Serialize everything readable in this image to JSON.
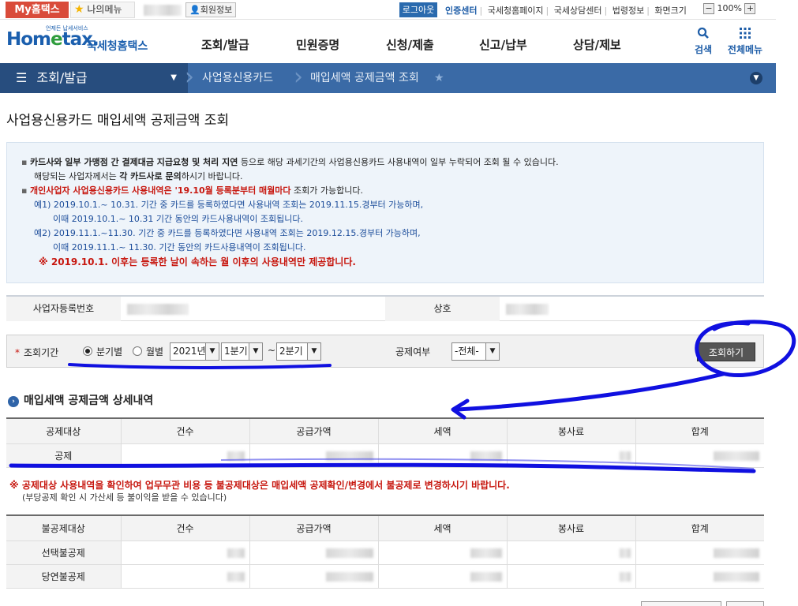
{
  "utility": {
    "my_tab": "My홈택스",
    "my_menu": "나의메뉴",
    "member_info": "회원정보",
    "logout": "로그아웃",
    "links": [
      "인증센터",
      "국세청홈페이지",
      "국세상담센터",
      "법령정보",
      "화면크기"
    ],
    "zoom_minus": "−",
    "zoom_level": "100%",
    "zoom_plus": "+"
  },
  "header": {
    "logo_small": "언제든 납세서비스",
    "logo_main_a": "Hom",
    "logo_main_b": "e",
    "logo_main_c": "tax.",
    "logo_org": "국세청홈택스",
    "menu": [
      "조회/발급",
      "민원증명",
      "신청/제출",
      "신고/납부",
      "상담/제보"
    ],
    "search": "검색",
    "all_menu": "전체메뉴",
    "icons": {
      "search": "search-icon",
      "all_menu": "grid-icon"
    }
  },
  "location": {
    "first": "조회/발급",
    "items": [
      "사업용신용카드",
      "매입세액 공제금액 조회"
    ]
  },
  "page_title": "사업용신용카드 매입세액 공제금액 조회",
  "info": {
    "line1_bold": "카드사와 일부 가맹점 간 결제대금 지급요청 및 처리 지연",
    "line1_rest": " 등으로 해당 과세기간의 사업용신용카드 사용내역이 일부 누락되어 조회 될 수 있습니다.",
    "line2_a": "해당되는 사업자께서는 ",
    "line2_bold": "각 카드사로 문의",
    "line2_b": "하시기 바랍니다.",
    "line3_red": "개인사업자 사업용신용카드 사용내역은 '19.10월 등록분부터 매월마다",
    "line3_rest": " 조회가 가능합니다.",
    "ex1a": "예1) 2019.10.1.~ 10.31. 기간 중 카드를 등록하였다면 사용내역 조회는 2019.11.15.경부터 가능하며,",
    "ex1b": "이때 2019.10.1.~ 10.31 기간 동안의 카드사용내역이 조회됩니다.",
    "ex2a": "예2) 2019.11.1.~11.30. 기간 중 카드를 등록하였다면 사용내역 조회는 2019.12.15.경부터 가능하며,",
    "ex2b": "이때 2019.11.1.~ 11.30. 기간 동안의 카드사용내역이 조회됩니다.",
    "warn": "※ 2019.10.1. 이후는 등록한 날이 속하는 월 이후의 사용내역만 제공합니다."
  },
  "business": {
    "reg_no_label": "사업자등록번호",
    "name_label": "상호"
  },
  "search": {
    "period_label": "조회기간",
    "radio_quarter": "분기별",
    "radio_month": "월별",
    "year": "2021년",
    "from_quarter": "1분기",
    "tilde": "~",
    "to_quarter": "2분기",
    "deduct_label": "공제여부",
    "deduct_value": "-전체-",
    "button": "조회하기"
  },
  "detail": {
    "title": "매입세액 공제금액 상세내역",
    "columns": [
      "공제대상",
      "건수",
      "공급가액",
      "세액",
      "봉사료",
      "합계"
    ],
    "rows": [
      {
        "label": "공제"
      }
    ]
  },
  "notes": {
    "warn": "※ 공제대상 사용내역을 확인하여 업무무관 비용 등 불공제대상은 매입세액 공제확인/변경에서 불공제로 변경하시기 바랍니다.",
    "sub": "(부당공제 확인 시 가산세 등 불이익을 받을 수 있습니다)"
  },
  "nondeduct": {
    "columns": [
      "불공제대상",
      "건수",
      "공급가액",
      "세액",
      "봉사료",
      "합계"
    ],
    "rows": [
      {
        "label": "선택불공제"
      },
      {
        "label": "당연불공제"
      }
    ]
  },
  "colors": {
    "brand_blue": "#1b5fae",
    "loc_bar": "#3a6aa6",
    "red": "#c7170f",
    "annotation": "#1010e0"
  }
}
